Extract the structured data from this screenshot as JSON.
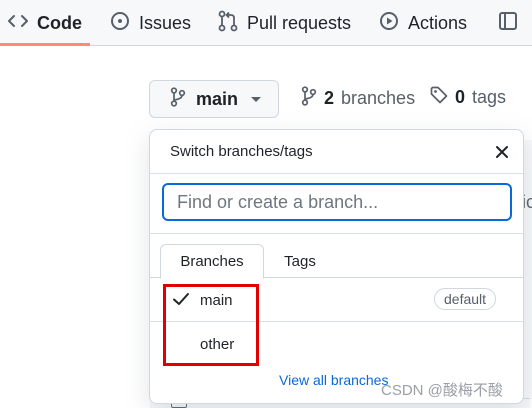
{
  "nav": {
    "code_label": "Code",
    "issues_label": "Issues",
    "pulls_label": "Pull requests",
    "actions_label": "Actions"
  },
  "branch_selector": {
    "current_branch": "main"
  },
  "counts": {
    "branches_count": "2",
    "branches_label": "branches",
    "tags_count": "0",
    "tags_label": "tags"
  },
  "background": {
    "edge_text": "ic"
  },
  "dropdown": {
    "title": "Switch branches/tags",
    "filter_placeholder": "Find or create a branch...",
    "tabs": [
      {
        "label": "Branches",
        "selected": true
      },
      {
        "label": "Tags",
        "selected": false
      }
    ],
    "branches": [
      {
        "name": "main",
        "checked": true,
        "badge": "default"
      },
      {
        "name": "other",
        "checked": false,
        "badge": ""
      }
    ],
    "footer_link": "View all branches"
  },
  "annotation": {
    "highlight_color": "#e00000"
  },
  "watermark": "CSDN @酸梅不酸",
  "colors": {
    "accent_blue": "#0969da",
    "nav_underline": "#fd8c73",
    "border": "#d0d7de"
  },
  "icons": [
    "code-icon",
    "issues-icon",
    "pull-request-icon",
    "actions-icon",
    "project-icon",
    "branch-icon",
    "tag-icon",
    "close-icon",
    "check-icon"
  ]
}
